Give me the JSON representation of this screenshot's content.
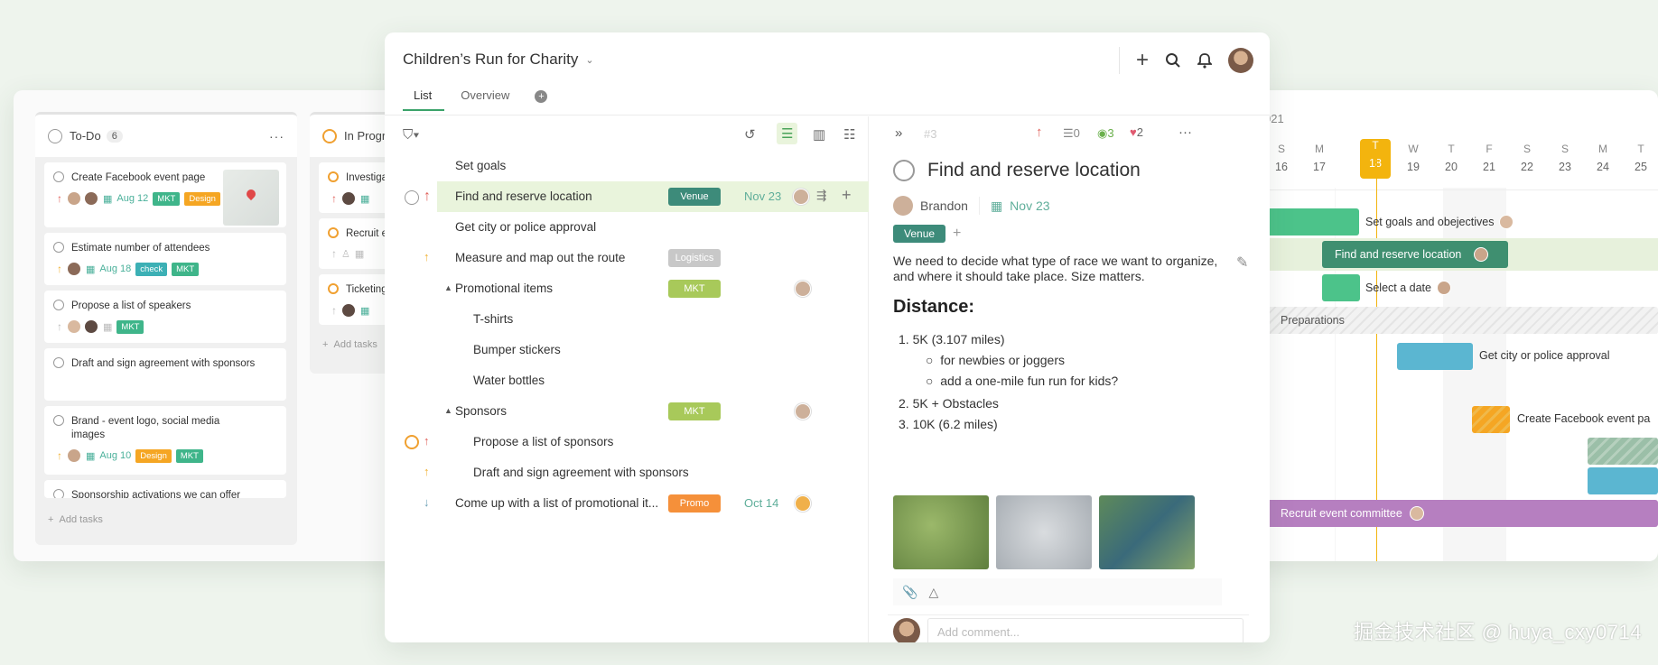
{
  "kanban": {
    "columns": [
      {
        "title": "To-Do",
        "count": "6"
      },
      {
        "title": "In Progr"
      }
    ],
    "todo_cards": [
      {
        "title": "Create Facebook event page",
        "date": "Aug 12",
        "tags": [
          "MKT",
          "Design"
        ]
      },
      {
        "title": "Estimate number of attendees",
        "date": "Aug 18",
        "tags": [
          "check",
          "MKT"
        ]
      },
      {
        "title": "Propose a list of speakers",
        "tags": [
          "MKT"
        ]
      },
      {
        "title": "Draft and sign agreement with sponsors"
      },
      {
        "title": "Brand - event logo, social media images",
        "date": "Aug 10",
        "tags": [
          "Design",
          "MKT"
        ]
      },
      {
        "title": "Sponsorship activations we can offer"
      }
    ],
    "progress_cards": [
      {
        "title": "Investigat"
      },
      {
        "title": "Recruit ev"
      },
      {
        "title": "Ticketing"
      }
    ],
    "add_tasks": "Add tasks",
    "add_tasks2": "Add tasks"
  },
  "main": {
    "title": "Children’s Run for Charity",
    "tabs": [
      "List",
      "Overview"
    ],
    "rows": [
      {
        "label": "Set goals"
      },
      {
        "label": "Find and reserve location",
        "tag": "Venue",
        "date": "Nov 23"
      },
      {
        "label": "Get city or police approval"
      },
      {
        "label": "Measure and map out the route",
        "tag": "Logistics"
      },
      {
        "label": "Promotional items",
        "tag": "MKT"
      },
      {
        "label": "T-shirts"
      },
      {
        "label": "Bumper stickers"
      },
      {
        "label": "Water bottles"
      },
      {
        "label": "Sponsors",
        "tag": "MKT"
      },
      {
        "label": "Propose a list of sponsors"
      },
      {
        "label": "Draft and sign agreement with sponsors"
      },
      {
        "label": "Come up with a list of promotional it...",
        "tag": "Promo",
        "date": "Oct 14"
      }
    ]
  },
  "detail": {
    "id": "#3",
    "comments_count": "0",
    "views_count": "3",
    "likes_count": "2",
    "title": "Find and reserve location",
    "assignee": "Brandon",
    "date": "Nov 23",
    "tag": "Venue",
    "description": "We need to decide what type of race we want to organize, and where it should take place. Size matters.",
    "heading": "Distance:",
    "list": [
      "1. 5K (3.107 miles)",
      "for newbies or joggers",
      "add a one-mile fun run for kids?",
      "2. 5K + Obstacles",
      "3. 10K (6.2 miles)"
    ],
    "comment_placeholder": "Add comment..."
  },
  "gantt": {
    "year": "021",
    "days": [
      {
        "d": "S",
        "n": "16"
      },
      {
        "d": "M",
        "n": "17"
      },
      {
        "d": "T",
        "n": "18"
      },
      {
        "d": "W",
        "n": "19"
      },
      {
        "d": "T",
        "n": "20"
      },
      {
        "d": "F",
        "n": "21"
      },
      {
        "d": "S",
        "n": "22"
      },
      {
        "d": "S",
        "n": "23"
      },
      {
        "d": "M",
        "n": "24"
      },
      {
        "d": "T",
        "n": "25"
      }
    ],
    "bars": [
      "Set goals and obejectives",
      "Find and reserve location",
      "Select a date",
      "Preparations",
      "Get city or police approval",
      "Create Facebook event pa",
      "Recruit event committee"
    ]
  },
  "watermark": "掘金技术社区 @ huya_cxy0714",
  "colors": {
    "accent": "#3aa36a",
    "venue": "#3d8b7a",
    "mkt": "#a8c95a",
    "promo": "#f5903a",
    "logistics": "#c8c8c8",
    "today": "#f3b40e"
  }
}
